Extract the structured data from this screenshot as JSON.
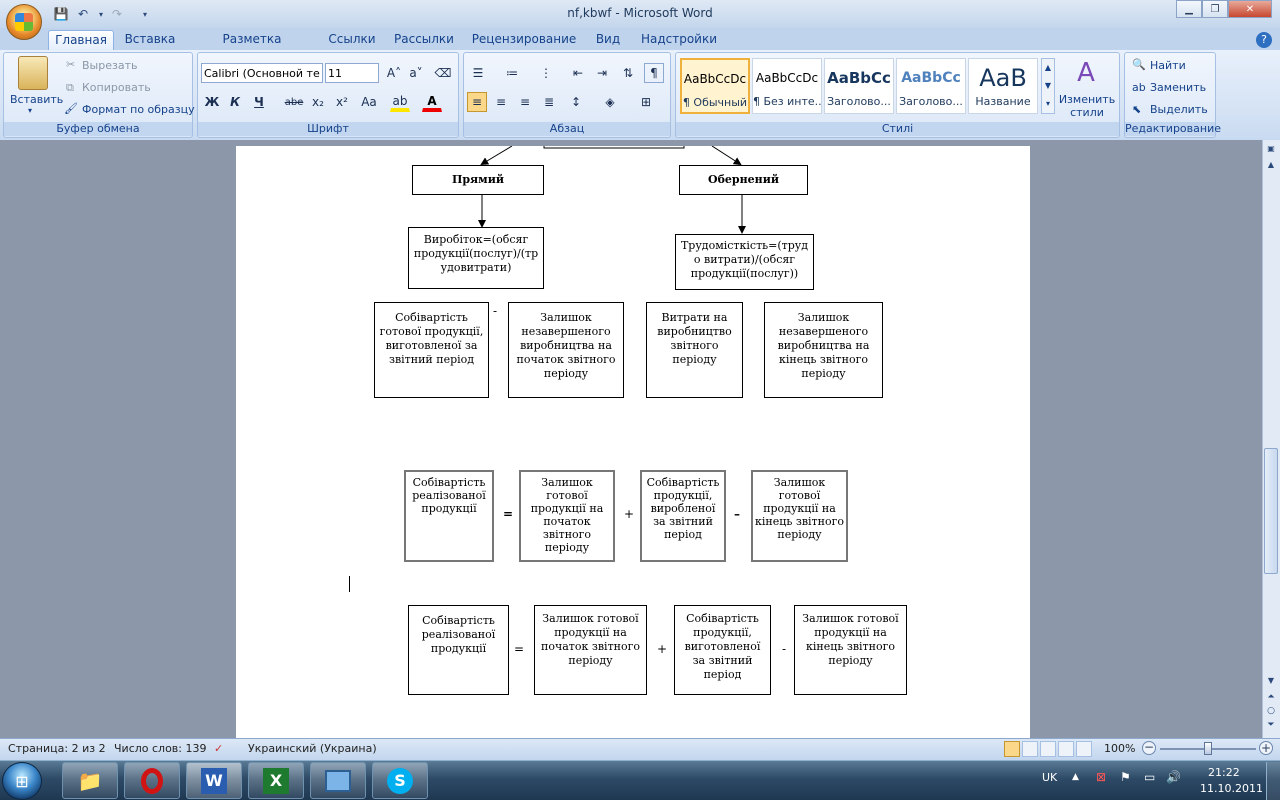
{
  "window": {
    "title": "nf,kbwf - Microsoft Word"
  },
  "tabs": [
    "Главная",
    "Вставка",
    "Разметка страницы",
    "Ссылки",
    "Рассылки",
    "Рецензирование",
    "Вид",
    "Надстройки"
  ],
  "ribbon": {
    "clipboard": {
      "label": "Буфер обмена",
      "paste": "Вставить",
      "cut": "Вырезать",
      "copy": "Копировать",
      "format_painter": "Формат по образцу"
    },
    "font": {
      "label": "Шрифт",
      "family": "Calibri (Основной те",
      "size": "11",
      "bold": "Ж",
      "italic": "К",
      "underline": "Ч",
      "strike": "abe",
      "sub": "x₂",
      "sup": "x²",
      "case": "Aa"
    },
    "paragraph": {
      "label": "Абзац"
    },
    "styles": {
      "label": "Стилі",
      "items": [
        {
          "preview": "AaBbCcDc",
          "name": "¶ Обычный"
        },
        {
          "preview": "AaBbCcDc",
          "name": "¶ Без инте..."
        },
        {
          "preview": "AaBbCc",
          "name": "Заголово..."
        },
        {
          "preview": "AaBbCc",
          "name": "Заголово..."
        },
        {
          "preview": "AaB",
          "name": "Название"
        }
      ],
      "change": "Изменить стили"
    },
    "editing": {
      "label": "Редактирование",
      "find": "Найти",
      "replace": "Заменить",
      "select": "Выделить"
    }
  },
  "doc": {
    "diagram1": {
      "direct": "Прямий",
      "inverse": "Обернений",
      "output_formula": "Виробіток=(обсяг продукції(послуг)/(тр удовитрати)",
      "labor_formula": "Трудомісткість=(труд о витрати)/(обсяг продукції(послуг))",
      "minus": "-"
    },
    "row1": [
      "Собівартість готової продукції, виготовленої за звітний період",
      "Залишок незавершеного виробництва на початок звітного періоду",
      "Витрати на виробництво звітного періоду",
      "Залишок незавершеного виробництва на кінець звітного періоду"
    ],
    "eq1": {
      "boxes": [
        "Собівартість реалізованої продукції",
        "Залишок готової продукції на початок звітного періоду",
        "Собівартість продукції, виробленої за звітний період",
        "Залишок готової продукції на кінець звітного періоду"
      ],
      "ops": [
        "=",
        "+",
        "–"
      ]
    },
    "eq2": {
      "boxes": [
        "Собівартість реалізованої продукції",
        "Залишок готової продукції на початок звітного періоду",
        "Собівартість продукції, виготовленої за звітний період",
        "Залишок готової продукції на кінець звітного періоду"
      ],
      "ops": [
        "=",
        "+",
        "-"
      ]
    }
  },
  "status": {
    "page": "Страница: 2 из 2",
    "words": "Число слов: 139",
    "language": "Украинский (Украина)",
    "zoom": "100%"
  },
  "tray": {
    "lang": "UK",
    "time": "21:22",
    "date": "11.10.2011"
  }
}
